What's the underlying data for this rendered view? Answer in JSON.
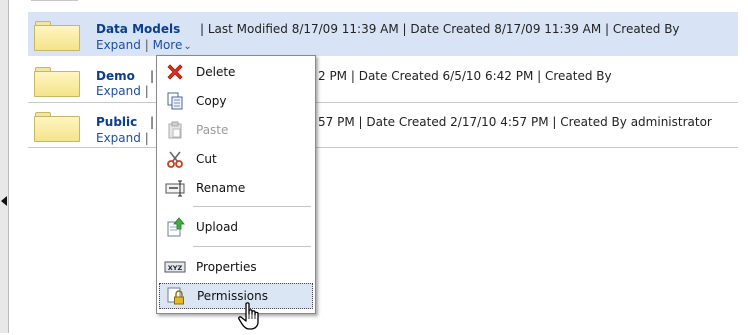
{
  "items": [
    {
      "name": "Data Models",
      "meta": "| Last Modified 8/17/09 11:39 AM | Date Created 8/17/09 11:39 AM | Created By",
      "expand_label": "Expand",
      "more_label": "More",
      "selected": true
    },
    {
      "name": "Demo",
      "name_suffix": "|",
      "meta": "2 PM | Date Created 6/5/10 6:42 PM | Created By",
      "expand_label": "Expand",
      "link_sep": "|"
    },
    {
      "name": "Public",
      "name_suffix": "|",
      "meta": "57 PM | Date Created 2/17/10 4:57 PM | Created By administrator",
      "expand_label": "Expand",
      "link_sep": "|"
    }
  ],
  "links_separator": "|",
  "context_menu": {
    "items": [
      {
        "label": "Delete",
        "icon": "delete-x-icon",
        "enabled": true
      },
      {
        "label": "Copy",
        "icon": "copy-icon",
        "enabled": true
      },
      {
        "label": "Paste",
        "icon": "paste-icon",
        "enabled": false
      },
      {
        "label": "Cut",
        "icon": "scissors-icon",
        "enabled": true
      },
      {
        "label": "Rename",
        "icon": "rename-icon",
        "enabled": true
      },
      {
        "label": "Upload",
        "icon": "upload-icon",
        "enabled": true
      },
      {
        "label": "Properties",
        "icon": "properties-icon",
        "enabled": true
      },
      {
        "label": "Permissions",
        "icon": "permissions-lock-icon",
        "enabled": true,
        "hovered": true
      }
    ]
  },
  "colors": {
    "selected_row": "#d8e4f6",
    "link": "#1f4fa0",
    "item_name": "#0b3d91",
    "menu_hover": "#dbe6f5"
  }
}
